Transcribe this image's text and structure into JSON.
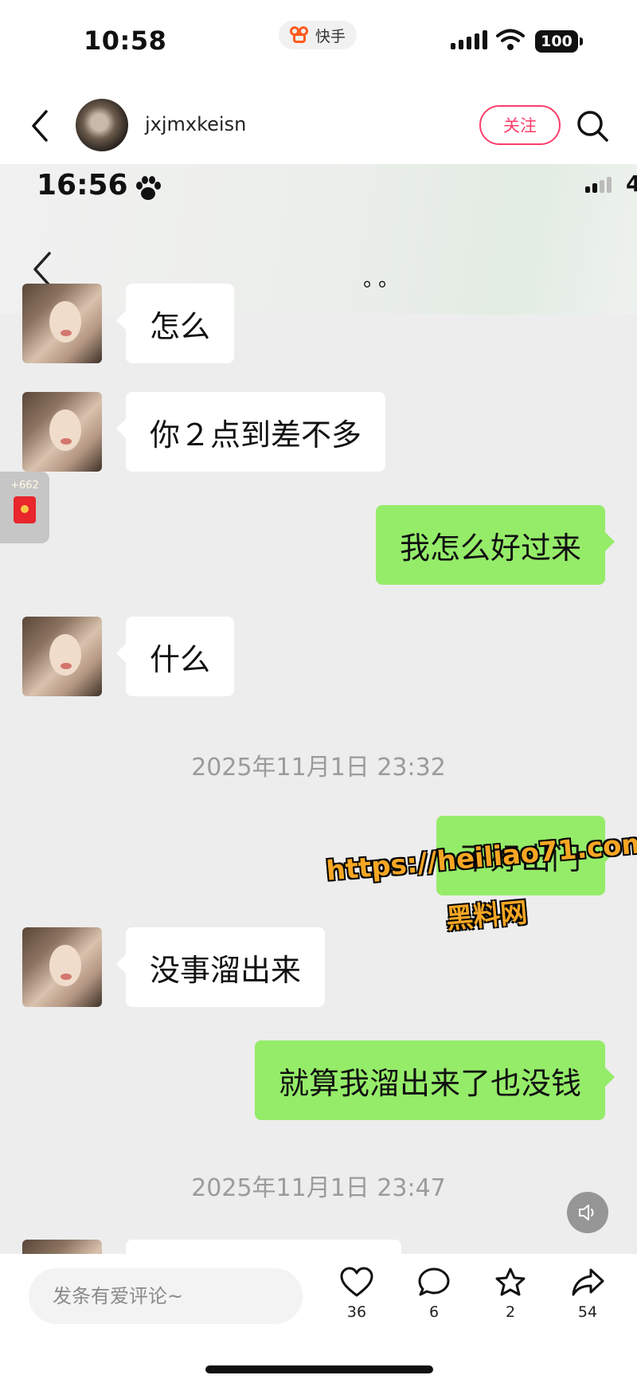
{
  "status_bar": {
    "time": "10:58",
    "app_name": "快手",
    "battery": "100"
  },
  "header": {
    "username": "jxjmxkeisn",
    "follow_label": "关注"
  },
  "screenshot": {
    "status_time": "16:56",
    "status_trailing": "4",
    "chat_title": "。。",
    "messages": [
      {
        "side": "left",
        "text": "怎么"
      },
      {
        "side": "left",
        "text": "你２点到差不多"
      },
      {
        "side": "right",
        "text": "我怎么好过来"
      },
      {
        "side": "left",
        "text": "什么"
      },
      {
        "type": "time",
        "text": "2025年11月1日 23:32"
      },
      {
        "side": "right",
        "text": "不好出门"
      },
      {
        "side": "left",
        "text": "没事溜出来"
      },
      {
        "side": "right",
        "text": "就算我溜出来了也没钱"
      },
      {
        "type": "time",
        "text": "2025年11月1日 23:47"
      }
    ],
    "watermark_url": "https://heiliao71.com",
    "watermark_name": "黑料网"
  },
  "reward": {
    "count": "+662"
  },
  "bottom": {
    "comment_placeholder": "发条有爱评论~",
    "like_count": "36",
    "comment_count": "6",
    "favorite_count": "2",
    "share_count": "54"
  },
  "colors": {
    "accent": "#ff3d6a",
    "bubble_green": "#95ec69",
    "watermark": "#f5a623"
  }
}
